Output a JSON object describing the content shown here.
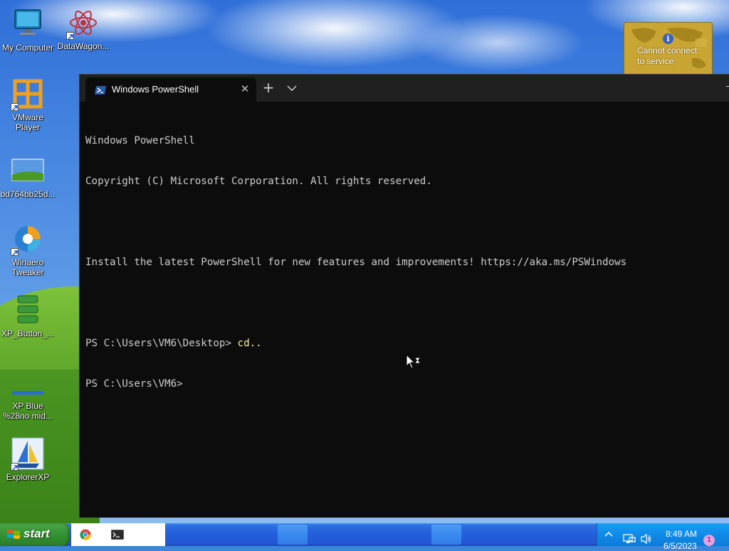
{
  "desktop": {
    "icons": [
      {
        "label": "My Computer",
        "icon": "monitor-icon"
      },
      {
        "label": "DataWagon...",
        "icon": "datawagon-icon"
      },
      {
        "label": "VMware Player",
        "icon": "vmware-icon"
      },
      {
        "label": "bd764bb25d...",
        "icon": "image-file-icon"
      },
      {
        "label": "Winaero Tweaker",
        "icon": "winaero-icon"
      },
      {
        "label": "XP_Button_...",
        "icon": "xp-button-icon"
      },
      {
        "label": "XP Blue %28no mid...",
        "icon": "xp-blue-icon"
      },
      {
        "label": "ExplorerXP",
        "icon": "explorerxp-icon"
      }
    ]
  },
  "balloon": {
    "message_line1": "Cannot connect",
    "message_line2": "to service",
    "icon": "info-icon"
  },
  "terminal": {
    "tab_title": "Windows PowerShell",
    "new_tab_symbol": "+",
    "close_symbol": "✕",
    "lines": [
      "Windows PowerShell",
      "Copyright (C) Microsoft Corporation. All rights reserved.",
      "",
      "Install the latest PowerShell for new features and improvements! https://aka.ms/PSWindows",
      "",
      "PS C:\\Users\\VM6\\Desktop> ",
      "PS C:\\Users\\VM6>"
    ],
    "command": "cd..",
    "colors": {
      "background": "#0c0c0c",
      "text": "#cccccc",
      "command": "#f9f1a5"
    }
  },
  "taskbar": {
    "start_label": "start",
    "quicklaunch": [
      "chrome-icon",
      "terminal-icon"
    ],
    "tray": {
      "time": "8:49 AM",
      "date": "6/5/2023",
      "notification_count": "1"
    }
  }
}
